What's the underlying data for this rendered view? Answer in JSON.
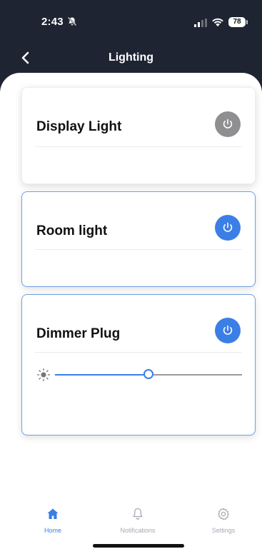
{
  "status_bar": {
    "time": "2:43",
    "battery": "78",
    "icons": [
      "bell-off-icon",
      "signal-icon",
      "wifi-icon",
      "battery-icon"
    ]
  },
  "nav": {
    "title": "Lighting",
    "back_icon": "chevron-left-icon"
  },
  "devices": [
    {
      "name": "Display Light",
      "power_state": "off",
      "power_icon": "power-icon"
    },
    {
      "name": "Room light",
      "power_state": "on",
      "power_icon": "power-icon"
    },
    {
      "name": "Dimmer Plug",
      "power_state": "on",
      "power_icon": "power-icon",
      "brightness_percent": 50,
      "brightness_icon": "sun-icon"
    }
  ],
  "tabs": [
    {
      "label": "Home",
      "icon": "home-icon",
      "active": true
    },
    {
      "label": "Notifications",
      "icon": "bell-icon",
      "active": false
    },
    {
      "label": "Settings",
      "icon": "gear-icon",
      "active": false
    }
  ],
  "colors": {
    "header_bg": "#1f2433",
    "accent": "#3b7fe6",
    "power_off": "#8f8f92",
    "inactive_tab": "#a5a9b2"
  }
}
